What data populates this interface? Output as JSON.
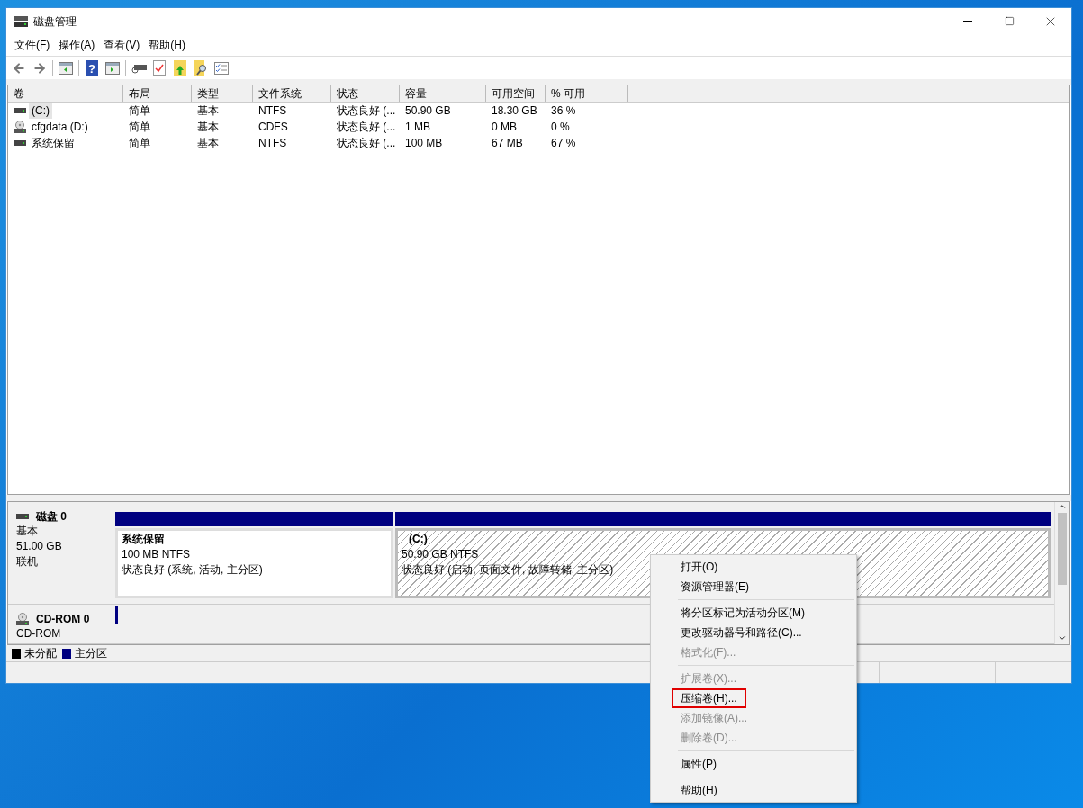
{
  "window": {
    "title": "磁盘管理"
  },
  "menu_bar": [
    "文件(F)",
    "操作(A)",
    "查看(V)",
    "帮助(H)"
  ],
  "volume_table": {
    "columns": [
      "卷",
      "布局",
      "类型",
      "文件系统",
      "状态",
      "容量",
      "可用空间",
      "% 可用"
    ],
    "rows": [
      {
        "kind": "disk",
        "selected": true,
        "cells": [
          "(C:)",
          "简单",
          "基本",
          "NTFS",
          "状态良好 (...",
          "50.90 GB",
          "18.30 GB",
          "36 %"
        ]
      },
      {
        "kind": "cd",
        "selected": false,
        "cells": [
          "cfgdata (D:)",
          "简单",
          "基本",
          "CDFS",
          "状态良好 (...",
          "1 MB",
          "0 MB",
          "0 %"
        ]
      },
      {
        "kind": "disk",
        "selected": false,
        "cells": [
          "系统保留",
          "简单",
          "基本",
          "NTFS",
          "状态良好 (...",
          "100 MB",
          "67 MB",
          "67 %"
        ]
      }
    ]
  },
  "disks": [
    {
      "kind": "disk",
      "name": "磁盘 0",
      "details": [
        "基本",
        "51.00 GB",
        "联机"
      ],
      "partitions": [
        {
          "title": "系统保留",
          "size": "100 MB NTFS",
          "status": "状态良好 (系统, 活动, 主分区)",
          "selected": false
        },
        {
          "title": "(C:)",
          "size": "50.90 GB NTFS",
          "status": "状态良好 (启动, 页面文件, 故障转储, 主分区)",
          "selected": true
        }
      ]
    },
    {
      "kind": "cd",
      "name": "CD-ROM 0",
      "details": [
        "CD-ROM"
      ]
    }
  ],
  "toolbar": {
    "help_mark": "?"
  },
  "legend": [
    {
      "label": "未分配",
      "color": "#000000"
    },
    {
      "label": "主分区",
      "color": "#000080"
    }
  ],
  "context_menu": [
    {
      "kind": "item",
      "label": "打开(O)",
      "disabled": false,
      "highlighted": false
    },
    {
      "kind": "item",
      "label": "资源管理器(E)",
      "disabled": false,
      "highlighted": false
    },
    {
      "kind": "separator"
    },
    {
      "kind": "item",
      "label": "将分区标记为活动分区(M)",
      "disabled": false,
      "highlighted": false
    },
    {
      "kind": "item",
      "label": "更改驱动器号和路径(C)...",
      "disabled": false,
      "highlighted": false
    },
    {
      "kind": "item",
      "label": "格式化(F)...",
      "disabled": true,
      "highlighted": false
    },
    {
      "kind": "separator"
    },
    {
      "kind": "item",
      "label": "扩展卷(X)...",
      "disabled": true,
      "highlighted": false
    },
    {
      "kind": "item",
      "label": "压缩卷(H)...",
      "disabled": false,
      "highlighted": true
    },
    {
      "kind": "item",
      "label": "添加镜像(A)...",
      "disabled": true,
      "highlighted": false
    },
    {
      "kind": "item",
      "label": "删除卷(D)...",
      "disabled": true,
      "highlighted": false
    },
    {
      "kind": "separator"
    },
    {
      "kind": "item",
      "label": "属性(P)",
      "disabled": false,
      "highlighted": false
    },
    {
      "kind": "separator"
    },
    {
      "kind": "item",
      "label": "帮助(H)",
      "disabled": false,
      "highlighted": false
    }
  ]
}
